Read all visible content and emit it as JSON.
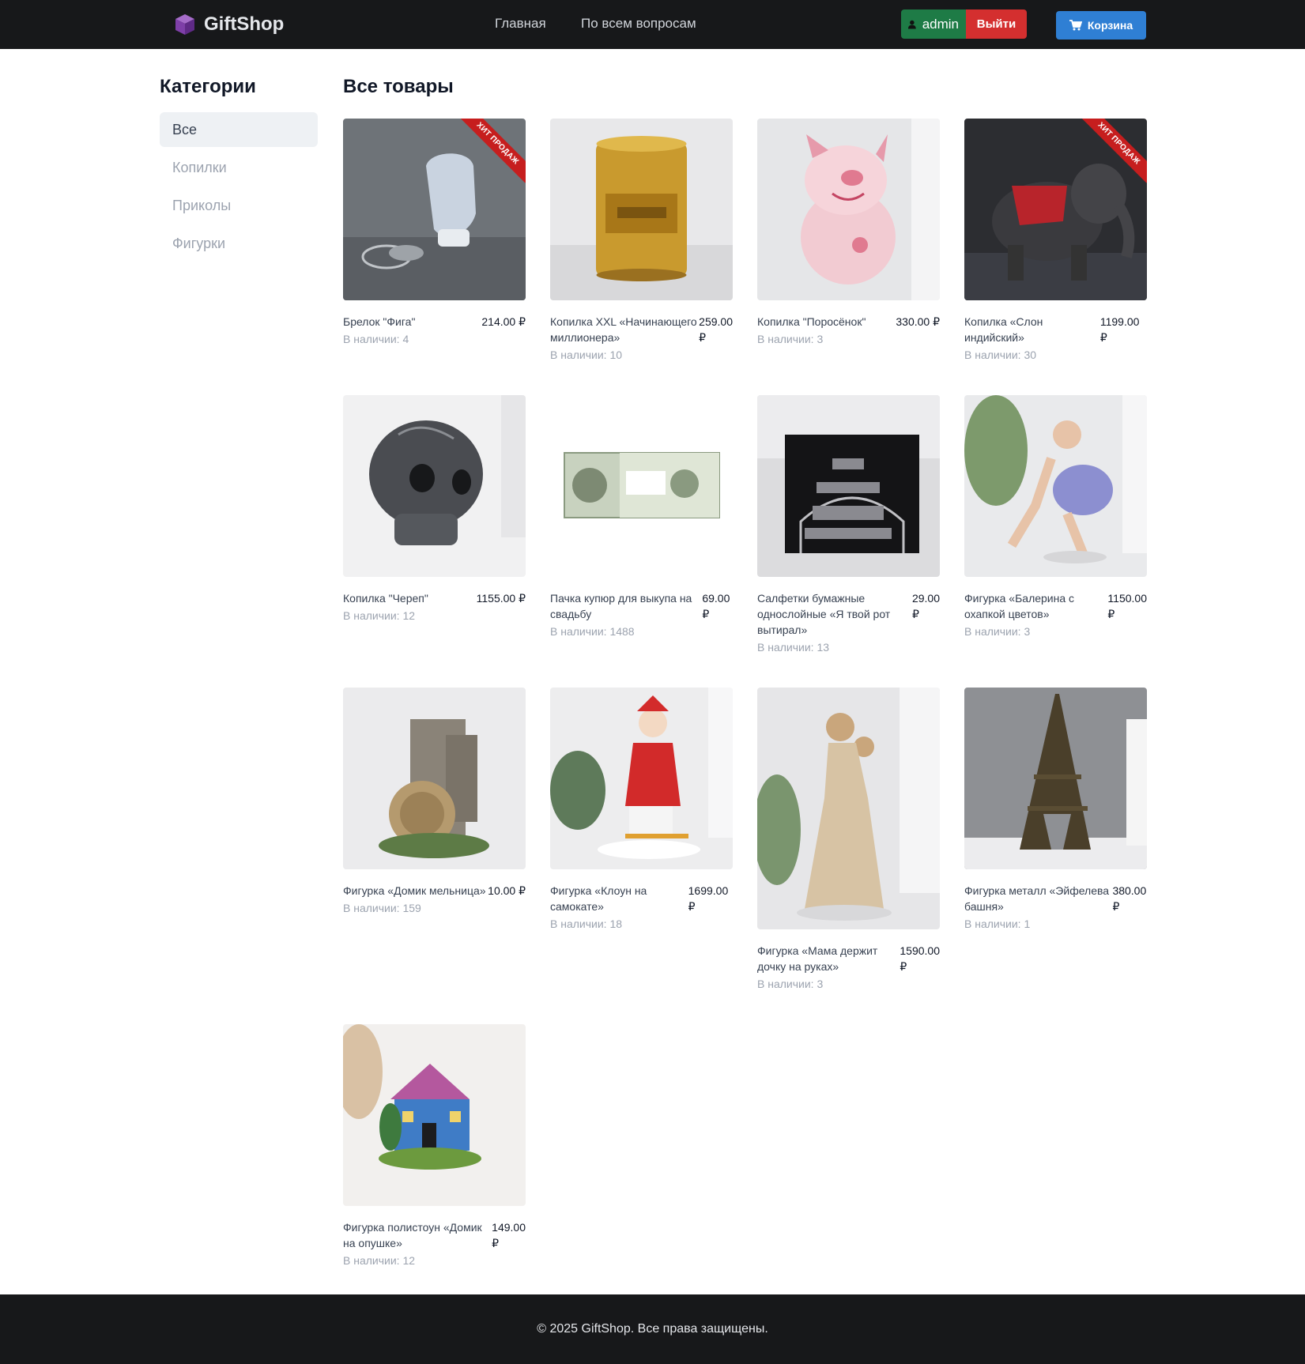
{
  "header": {
    "brand": "GiftShop",
    "nav": [
      "Главная",
      "По всем вопросам"
    ],
    "user": "admin",
    "logout": "Выйти",
    "cart": "Корзина",
    "colors": {
      "bg": "#17181a",
      "user": "#1e7b46",
      "logout": "#d42f2f",
      "cart": "#2f7fd4"
    }
  },
  "sidebar": {
    "title": "Категории",
    "items": [
      "Все",
      "Копилки",
      "Приколы",
      "Фигурки"
    ],
    "active": "Все"
  },
  "main": {
    "title": "Все товары",
    "badge": "ХИТ ПРОДАЖ",
    "products": [
      {
        "name": "Брелок \"Фига\"",
        "price": "214.00 ₽",
        "stock": "В наличии: 4",
        "hit": true,
        "image": "keychain-fist-image"
      },
      {
        "name": "Копилка XXL «Начинающего миллионера»",
        "price": "259.00 ₽",
        "stock": "В наличии: 10",
        "hit": false,
        "image": "gold-can-image"
      },
      {
        "name": "Копилка \"Поросёнок\"",
        "price": "330.00 ₽",
        "stock": "В наличии: 3",
        "hit": false,
        "image": "piggy-bank-image"
      },
      {
        "name": "Копилка «Слон индийский»",
        "price": "1199.00 ₽",
        "stock": "В наличии: 30",
        "hit": true,
        "image": "elephant-image"
      },
      {
        "name": "Копилка \"Череп\"",
        "price": "1155.00 ₽",
        "stock": "В наличии: 12",
        "hit": false,
        "image": "skull-image"
      },
      {
        "name": "Пачка купюр для выкупа на свадьбу",
        "price": "69.00 ₽",
        "stock": "В наличии: 1488",
        "hit": false,
        "image": "banknotes-image"
      },
      {
        "name": "Салфетки бумажные однослойные «Я твой рот вытирал»",
        "price": "29.00 ₽",
        "stock": "В наличии: 13",
        "hit": false,
        "image": "napkins-image"
      },
      {
        "name": "Фигурка «Балерина с охапкой цветов»",
        "price": "1150.00 ₽",
        "stock": "В наличии: 3",
        "hit": false,
        "image": "ballerina-image"
      },
      {
        "name": "Фигурка «Домик мельница»",
        "price": "10.00 ₽",
        "stock": "В наличии: 159",
        "hit": false,
        "image": "mill-house-image"
      },
      {
        "name": "Фигурка «Клоун на самокате»",
        "price": "1699.00 ₽",
        "stock": "В наличии: 18",
        "hit": false,
        "image": "clown-image"
      },
      {
        "name": "Фигурка «Мама держит дочку на руках»",
        "price": "1590.00 ₽",
        "stock": "В наличии: 3",
        "hit": false,
        "image": "mother-daughter-image"
      },
      {
        "name": "Фигурка металл «Эйфелева башня»",
        "price": "380.00 ₽",
        "stock": "В наличии: 1",
        "hit": false,
        "image": "eiffel-tower-image"
      },
      {
        "name": "Фигурка полистоун «Домик на опушке»",
        "price": "149.00 ₽",
        "stock": "В наличии: 12",
        "hit": false,
        "image": "blue-house-image"
      }
    ]
  },
  "footer": {
    "text": "© 2025 GiftShop. Все права защищены."
  }
}
